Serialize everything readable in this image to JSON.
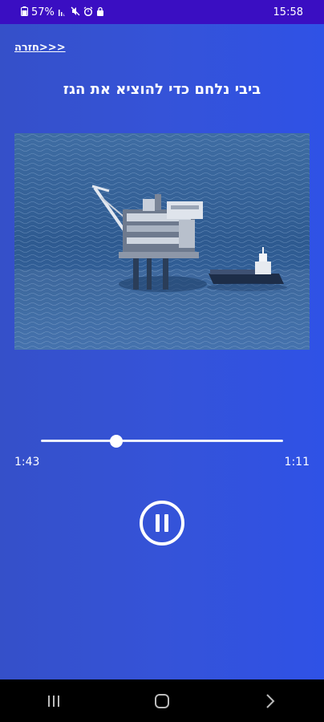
{
  "status_bar": {
    "battery": "57%",
    "time": "15:58"
  },
  "header": {
    "back_label": "חזרה>>>",
    "title": "ביבי נלחם כדי להוציא את הגז"
  },
  "player": {
    "elapsed": "1:43",
    "remaining": "1:11",
    "progress": 0.31,
    "state": "playing"
  },
  "nav_bar": {
    "items": [
      "recent-apps-icon",
      "home-icon",
      "back-icon"
    ]
  },
  "colors": {
    "status_bar": "#3a0ec2",
    "background": "#2d4ddd",
    "nav_bar": "#000000"
  }
}
